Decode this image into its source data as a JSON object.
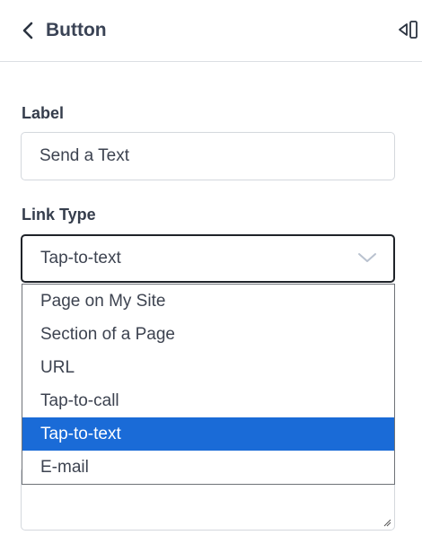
{
  "header": {
    "title": "Button",
    "back_icon": "chevron-left-icon",
    "collapse_icon": "collapse-panel-icon"
  },
  "label_field": {
    "label": "Label",
    "value": "Send a Text"
  },
  "link_type": {
    "label": "Link Type",
    "selected": "Tap-to-text",
    "options": [
      "Page on My Site",
      "Section of a Page",
      "URL",
      "Tap-to-call",
      "Tap-to-text",
      "E-mail"
    ],
    "highlighted_index": 4
  },
  "colors": {
    "highlight": "#1a6bd7",
    "text": "#3d4350",
    "border": "#d4d8dd"
  }
}
